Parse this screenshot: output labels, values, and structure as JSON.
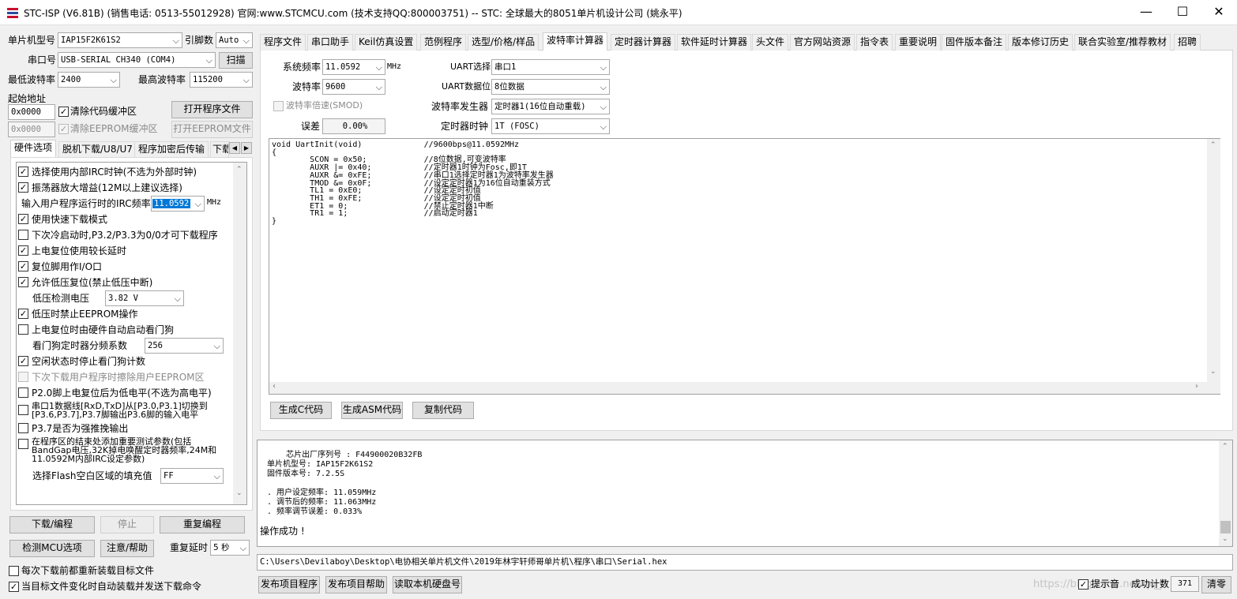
{
  "window": {
    "title": "STC-ISP (V6.81B) (销售电话: 0513-55012928) 官网:www.STCMCU.com  (技术支持QQ:800003751)  -- STC: 全球最大的8051单片机设计公司 (姚永平)",
    "minimize": "—",
    "maximize": "☐",
    "close": "✕"
  },
  "left": {
    "mcu_type_label": "单片机型号",
    "mcu_type_value": "IAP15F2K61S2",
    "pins_label": "引脚数",
    "pins_value": "Auto",
    "port_label": "串口号",
    "port_value": "USB-SERIAL CH340 (COM4)",
    "scan_button": "扫描",
    "min_baud_label": "最低波特率",
    "min_baud_value": "2400",
    "max_baud_label": "最高波特率",
    "max_baud_value": "115200",
    "start_addr_label": "起始地址",
    "addr1": "0x0000",
    "clear_code_label": "清除代码缓冲区",
    "open_prog_button": "打开程序文件",
    "addr2": "0x0000",
    "clear_eeprom_label": "清除EEPROM缓冲区",
    "open_eeprom_button": "打开EEPROM文件",
    "subtabs": [
      "硬件选项",
      "脱机下载/U8/U7",
      "程序加密后传输",
      "下载"
    ],
    "hw_options": [
      {
        "checked": true,
        "label": "选择使用内部IRC时钟(不选为外部时钟)"
      },
      {
        "checked": true,
        "label": "振荡器放大增益(12M以上建议选择)"
      },
      {
        "label": "输入用户程序运行时的IRC频率",
        "value": "11.0592",
        "unit": "MHz"
      },
      {
        "checked": true,
        "label": "使用快速下载模式"
      },
      {
        "checked": false,
        "label": "下次冷启动时,P3.2/P3.3为0/0才可下载程序"
      },
      {
        "checked": true,
        "label": "上电复位使用较长延时"
      },
      {
        "checked": true,
        "label": "复位脚用作I/O口"
      },
      {
        "checked": true,
        "label": "允许低压复位(禁止低压中断)"
      },
      {
        "label": "低压检测电压",
        "value": "3.82 V"
      },
      {
        "checked": true,
        "label": "低压时禁止EEPROM操作"
      },
      {
        "checked": false,
        "label": "上电复位时由硬件自动启动看门狗"
      },
      {
        "label": "看门狗定时器分频系数",
        "value": "256"
      },
      {
        "checked": true,
        "label": "空闲状态时停止看门狗计数"
      },
      {
        "checked": false,
        "disabled": true,
        "label": "下次下载用户程序时擦除用户EEPROM区"
      },
      {
        "checked": false,
        "label": "P2.0脚上电复位后为低电平(不选为高电平)"
      },
      {
        "checked": false,
        "label": "串口1数据线[RxD,TxD]从[P3.0,P3.1]切换到",
        "label2": "[P3.6,P3.7],P3.7脚输出P3.6脚的输入电平"
      },
      {
        "checked": false,
        "label": "P3.7是否为强推挽输出"
      },
      {
        "checked": false,
        "label": "在程序区的结束处添加重要测试参数(包括",
        "label2": "BandGap电压,32K掉电唤醒定时器频率,24M和",
        "label3": "11.0592M内部IRC设定参数)"
      },
      {
        "label": "选择Flash空白区域的填充值",
        "value": "FF"
      }
    ],
    "download_button": "下载/编程",
    "stop_button": "停止",
    "reprogram_button": "重复编程",
    "detect_button": "检测MCU选项",
    "help_button": "注意/帮助",
    "repeat_delay_label": "重复延时",
    "repeat_delay_value": "5 秒",
    "reload_label": "每次下载前都重新装载目标文件",
    "auto_label": "当目标文件变化时自动装载并发送下载命令"
  },
  "tabs": [
    "程序文件",
    "串口助手",
    "Keil仿真设置",
    "范例程序",
    "选型/价格/样品",
    "波特率计算器",
    "定时器计算器",
    "软件延时计算器",
    "头文件",
    "官方网站资源",
    "指令表",
    "重要说明",
    "固件版本备注",
    "版本修订历史",
    "联合实验室/推荐教材",
    "招聘"
  ],
  "baud": {
    "sysfreq_label": "系统频率",
    "sysfreq_value": "11.0592",
    "sysfreq_unit": "MHz",
    "uart_sel_label": "UART选择",
    "uart_sel_value": "串口1",
    "baud_label": "波特率",
    "baud_value": "9600",
    "uart_bits_label": "UART数据位",
    "uart_bits_value": "8位数据",
    "smod_label": "波特率倍速(SMOD)",
    "gen_label": "波特率发生器",
    "gen_value": "定时器1(16位自动重载)",
    "error_label": "误差",
    "error_value": "0.00%",
    "timer_clock_label": "定时器时钟",
    "timer_clock_value": "1T  (FOSC)",
    "code": "void UartInit(void)\t\t//9600bps@11.0592MHz\n{\n\tSCON = 0x50;\t\t//8位数据,可变波特率\n\tAUXR |= 0x40;\t\t//定时器1时钟为Fosc,即1T\n\tAUXR &= 0xFE;\t\t//串口1选择定时器1为波特率发生器\n\tTMOD &= 0x0F;\t\t//设定定时器1为16位自动重装方式\n\tTL1 = 0xE0;\t\t//设定定时初值\n\tTH1 = 0xFE;\t\t//设定定时初值\n\tET1 = 0;\t\t//禁止定时器1中断\n\tTR1 = 1;\t\t//启动定时器1\n}",
    "gen_c_button": "生成C代码",
    "gen_asm_button": "生成ASM代码",
    "copy_button": "复制代码"
  },
  "output": {
    "text": "    芯片出厂序列号 : F44900020B32FB\n单片机型号: IAP15F2K61S2\n固件版本号: 7.2.5S\n\n. 用户设定频率: 11.059MHz\n. 调节后的频率: 11.063MHz\n. 频率调节误差: 0.033%\n",
    "status": "操作成功 !"
  },
  "file_path": "C:\\Users\\Devilaboy\\Desktop\\电协相关单片机文件\\2019年林宇轩师哥单片机\\程序\\串口\\Serial.hex",
  "bottom": {
    "publish_prog": "发布项目程序",
    "publish_help": "发布项目帮助",
    "read_disk": "读取本机硬盘号",
    "watermark": "https://blog.csdn.net/qq_4",
    "tone_label": "提示音",
    "success_label": "成功计数",
    "success_value": "371",
    "clear_button": "清零"
  }
}
